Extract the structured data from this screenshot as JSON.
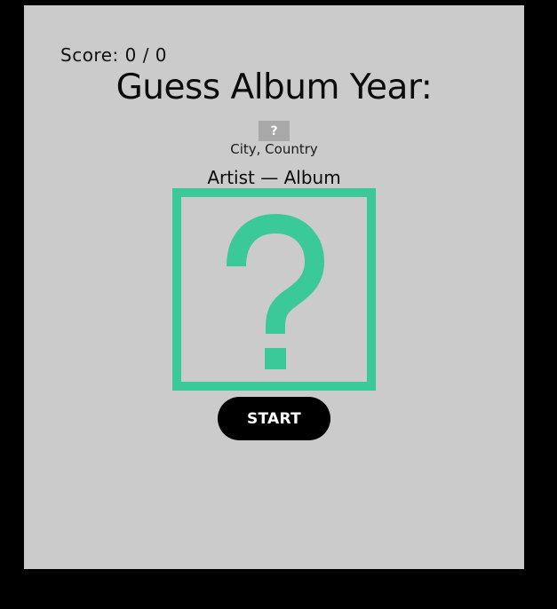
{
  "score": {
    "text": "Score: 0 / 0"
  },
  "title": "Guess Album Year:",
  "flag": {
    "icon": "question-mark-icon",
    "glyph": "?"
  },
  "location": "City, Country",
  "album_line": "Artist — Album",
  "cover": {
    "icon": "question-mark-icon",
    "accent_color": "#3cc99a"
  },
  "start_button": {
    "label": "START"
  },
  "colors": {
    "panel": "#cbcbcb",
    "background": "#000000",
    "accent": "#3cc99a",
    "button": "#000000"
  }
}
